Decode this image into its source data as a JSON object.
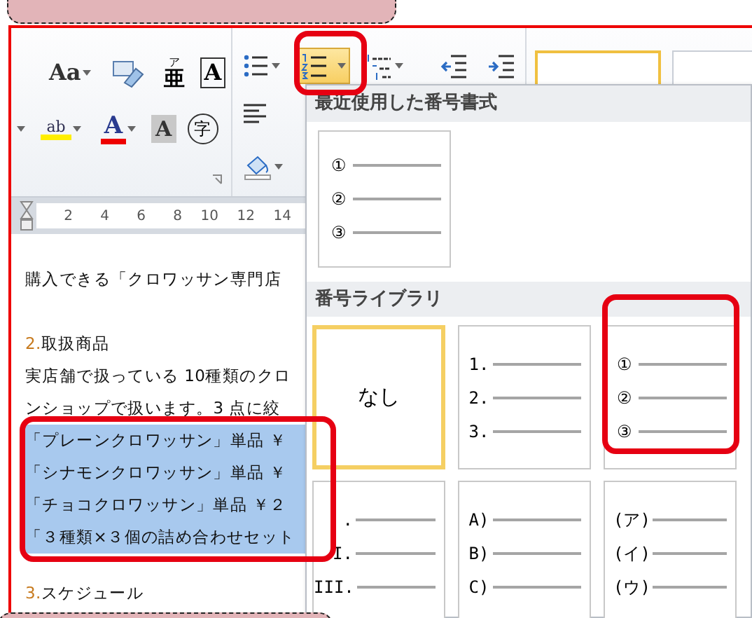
{
  "ribbon": {
    "font_row_1": [
      {
        "kind": "change-case",
        "label": "Aa"
      },
      {
        "kind": "clear-format"
      },
      {
        "kind": "ruby",
        "label": "亜",
        "ruby": "ア"
      },
      {
        "kind": "char-border",
        "label": "A"
      }
    ],
    "font_row_2": [
      {
        "kind": "highlight",
        "label": "ab"
      },
      {
        "kind": "font-color",
        "label": "A"
      },
      {
        "kind": "char-shading",
        "label": "A"
      },
      {
        "kind": "enclose",
        "label": "字"
      }
    ],
    "paragraph_row_1": [
      {
        "kind": "bullets",
        "selected": false
      },
      {
        "kind": "numbering",
        "selected": true
      },
      {
        "kind": "multilevel",
        "selected": false
      },
      {
        "kind": "outdent",
        "selected": false
      },
      {
        "kind": "indent",
        "selected": false
      }
    ],
    "paragraph_row_2": [
      {
        "kind": "align-left"
      },
      {
        "kind": "shading"
      }
    ],
    "styles": [
      {
        "selected": true
      },
      {
        "selected": false
      }
    ]
  },
  "ruler": {
    "ticks": [
      "2",
      "4",
      "6",
      "8",
      "10",
      "12",
      "14"
    ]
  },
  "document": [
    [
      {
        "text": "購入できる「クロワッサン専門店",
        "selected": false
      }
    ],
    [
      {
        "number": "2.",
        "text": "取扱商品",
        "selected": false
      },
      {
        "text": "実店舗で扱っている 10種類のクロ",
        "selected": false
      },
      {
        "text": "ンショップで扱います。3 点に絞",
        "selected": false
      },
      {
        "text": "「プレーンクロワッサン」単品 ￥",
        "selected": true
      },
      {
        "text": "「シナモンクロワッサン」単品 ￥",
        "selected": true
      },
      {
        "text": "「チョコクロワッサン」単品 ￥２",
        "selected": true
      },
      {
        "text": "「３種類×３個の詰め合わせセット",
        "selected": true
      }
    ],
    [
      {
        "number": "3.",
        "text": "スケジュール",
        "selected": false
      }
    ]
  ],
  "numbering_menu": {
    "recent_header": "最近使用した番号書式",
    "recent": [
      {
        "markers": [
          "①",
          "②",
          "③"
        ],
        "selected": false
      }
    ],
    "library_header": "番号ライブラリ",
    "library": [
      {
        "kind": "none",
        "label": "なし",
        "selected": true
      },
      {
        "kind": "list",
        "markers": [
          "1.",
          "2.",
          "3."
        ],
        "selected": false
      },
      {
        "kind": "list",
        "markers": [
          "①",
          "②",
          "③"
        ],
        "selected": false
      },
      {
        "kind": "list",
        "markers": [
          ".",
          "I.",
          "III."
        ],
        "selected": false
      },
      {
        "kind": "list",
        "markers": [
          "A)",
          "B)",
          "C)"
        ],
        "selected": false
      },
      {
        "kind": "list",
        "markers": [
          "(ア)",
          "(イ)",
          "(ウ)"
        ],
        "selected": false
      }
    ]
  }
}
